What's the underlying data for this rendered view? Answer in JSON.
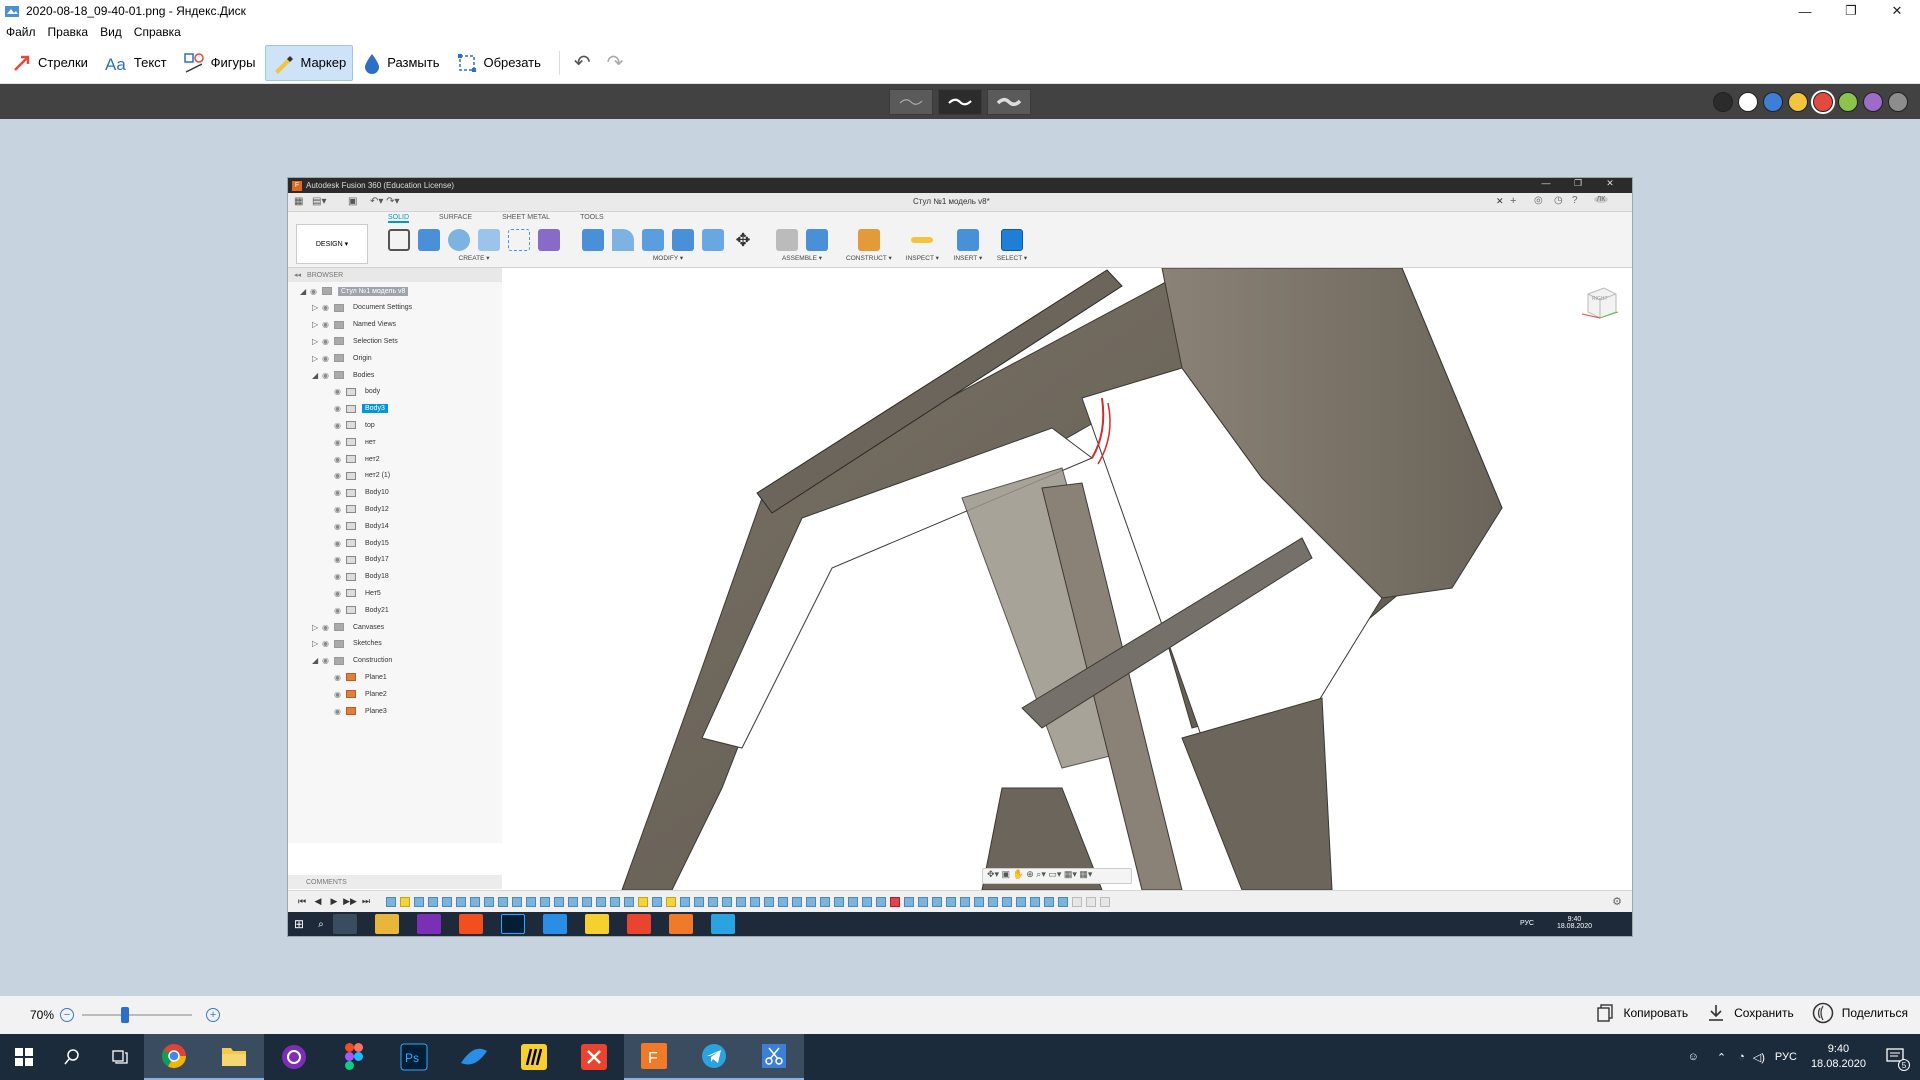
{
  "window": {
    "title": "2020-08-18_09-40-01.png - Яндекс.Диск",
    "controls": [
      "—",
      "❐",
      "✕"
    ]
  },
  "menu": [
    "Файл",
    "Правка",
    "Вид",
    "Справка"
  ],
  "toolbar": {
    "arrows": "Стрелки",
    "text": "Текст",
    "shapes": "Фигуры",
    "marker": "Маркер",
    "blur": "Размыть",
    "crop": "Обрезать",
    "undo": "↶",
    "redo": "↷"
  },
  "stroke_widths": [
    "thin",
    "medium",
    "thick"
  ],
  "palette": [
    "#2b2b2b",
    "#ffffff",
    "#3d7fd6",
    "#f3c53c",
    "#e24a3f",
    "#8ac44a",
    "#9b6cc8",
    "#8d8d8d"
  ],
  "fusion": {
    "title": "Autodesk Fusion 360 (Education License)",
    "doc_tab": "Стул №1 модель v8*",
    "user_initials": "ЛК",
    "design": "DESIGN ▾",
    "tabs": [
      "SOLID",
      "SURFACE",
      "SHEET METAL",
      "TOOLS"
    ],
    "groups": [
      "CREATE ▾",
      "MODIFY ▾",
      "ASSEMBLE ▾",
      "CONSTRUCT ▾",
      "INSPECT ▾",
      "INSERT ▾",
      "SELECT ▾"
    ],
    "browser_title": "BROWSER",
    "root": "Стул №1 модель v8",
    "tree": [
      {
        "label": "Document Settings"
      },
      {
        "label": "Named Views"
      },
      {
        "label": "Selection Sets"
      },
      {
        "label": "Origin"
      },
      {
        "label": "Bodies"
      }
    ],
    "bodies": [
      "body",
      "Body3",
      "top",
      "нет",
      "нет2",
      "нет2 (1)",
      "Body10",
      "Body12",
      "Body14",
      "Body15",
      "Body17",
      "Body18",
      "Нет5",
      "Body21"
    ],
    "tree2": [
      {
        "label": "Canvases"
      },
      {
        "label": "Sketches"
      },
      {
        "label": "Construction"
      }
    ],
    "planes": [
      "Plane1",
      "Plane2",
      "Plane3"
    ],
    "comments": "COMMENTS",
    "viewcube": "RIGHT",
    "time": "9:40",
    "date": "18.08.2020",
    "lang": "РУС"
  },
  "zoom": {
    "value": "70%",
    "level": 0.38
  },
  "actions": {
    "copy": "Копировать",
    "save": "Сохранить",
    "share": "Поделиться"
  },
  "taskbar": {
    "lang": "РУС",
    "time": "9:40",
    "date": "18.08.2020",
    "badge": "5"
  }
}
